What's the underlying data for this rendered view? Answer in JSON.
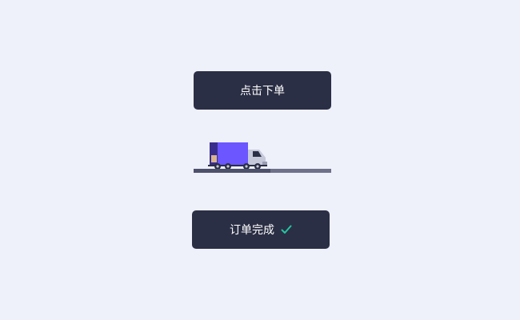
{
  "order_button": {
    "label": "点击下单"
  },
  "delivery": {
    "progress": 0.56,
    "vehicle_icon": "truck-icon"
  },
  "done_button": {
    "label": "订单完成",
    "icon": "checkmark-icon"
  },
  "colors": {
    "background": "#eef0fa",
    "button": "#2b2f45",
    "button_text": "#ffffff",
    "accent_check": "#24c6a0",
    "truck_body": "#6b56ff",
    "truck_cab": "#c5c8d8",
    "road": "#6e7189"
  }
}
